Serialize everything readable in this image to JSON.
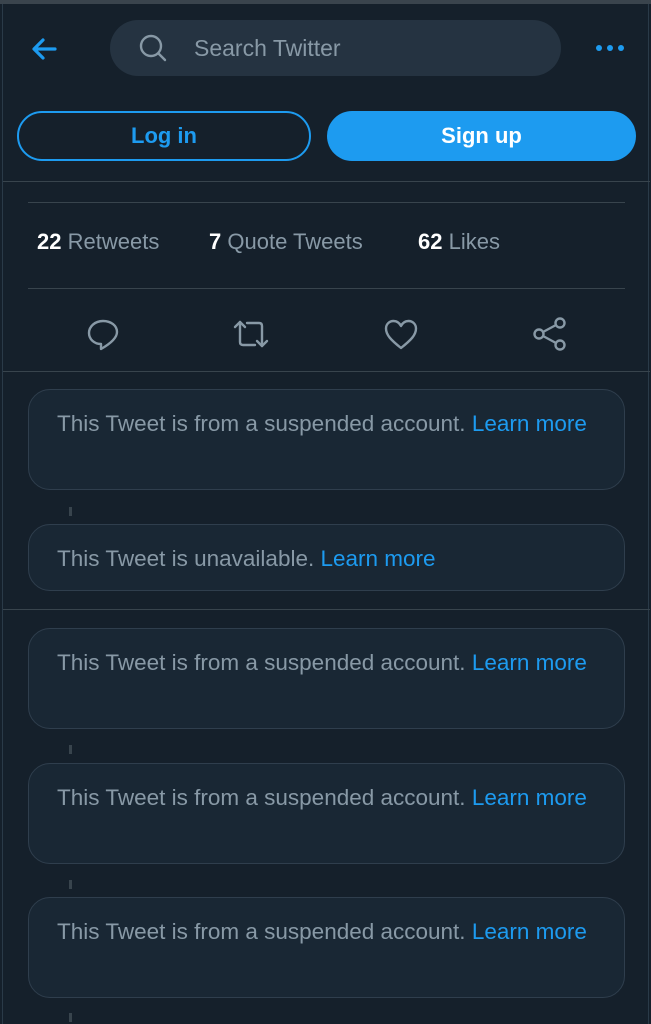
{
  "header": {
    "search_placeholder": "Search Twitter"
  },
  "auth": {
    "login_label": "Log in",
    "signup_label": "Sign up"
  },
  "stats": {
    "retweets_count": "22",
    "retweets_label": "Retweets",
    "quotes_count": "7",
    "quotes_label": "Quote Tweets",
    "likes_count": "62",
    "likes_label": "Likes"
  },
  "icons": [
    "back-arrow-icon",
    "search-icon",
    "more-icon",
    "reply-icon",
    "retweet-icon",
    "like-icon",
    "share-icon"
  ],
  "colors": {
    "background": "#15202b",
    "card": "#192734",
    "accent": "#1d9bf0",
    "text_secondary": "#8899a6"
  },
  "tweets": [
    {
      "text": "This Tweet is from a suspended account.",
      "link": "Learn more"
    },
    {
      "text": "This Tweet is unavailable.",
      "link": "Learn more"
    },
    {
      "text": "This Tweet is from a suspended account.",
      "link": "Learn more"
    },
    {
      "text": "This Tweet is from a suspended account.",
      "link": "Learn more"
    },
    {
      "text": "This Tweet is from a suspended account.",
      "link": "Learn more"
    }
  ]
}
